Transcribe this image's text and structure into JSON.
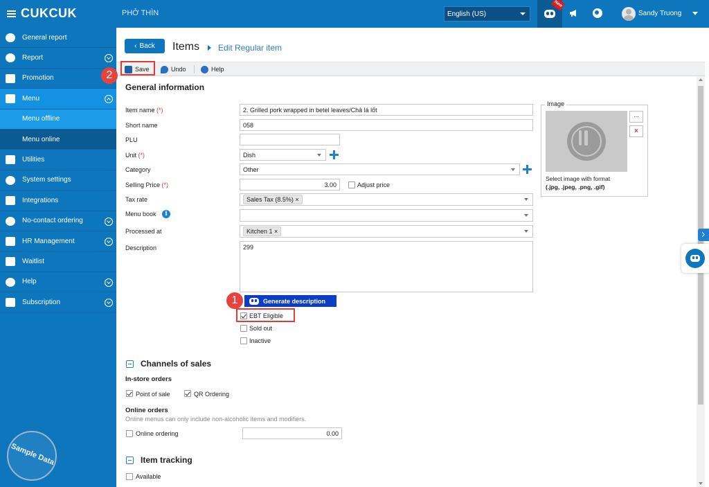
{
  "topbar": {
    "logo": "CUKCUK",
    "restaurant": "PHỞ THÌN",
    "language": "English (US)",
    "new_badge": "New",
    "user_name": "Sandy Truong"
  },
  "sidebar": {
    "items": [
      {
        "label": "General report"
      },
      {
        "label": "Report"
      },
      {
        "label": "Promotion"
      },
      {
        "label": "Menu"
      },
      {
        "label": "Menu offline"
      },
      {
        "label": "Menu online"
      },
      {
        "label": "Utilities"
      },
      {
        "label": "System settings"
      },
      {
        "label": "Integrations"
      },
      {
        "label": "No-contact ordering"
      },
      {
        "label": "HR Management"
      },
      {
        "label": "Waitlist"
      },
      {
        "label": "Help"
      },
      {
        "label": "Subscription"
      }
    ],
    "badge": "Sample Data"
  },
  "header": {
    "back_label": "Back",
    "title": "Items",
    "subtitle": "Edit Regular item"
  },
  "toolbar": {
    "save_label": "Save",
    "undo_label": "Undo",
    "help_label": "Help"
  },
  "markers": {
    "one": "1",
    "two": "2"
  },
  "general": {
    "title": "General information",
    "required_mark": "(*)",
    "item_name_label": "Item name",
    "item_name_value": "2. Grilled pork wrapped in betel leaves/Chả lá lốt",
    "short_name_label": "Short name",
    "short_name_value": "058",
    "plu_label": "PLU",
    "plu_value": "",
    "unit_label": "Unit",
    "unit_value": "Dish",
    "category_label": "Category",
    "category_value": "Other",
    "selling_price_label": "Selling Price",
    "selling_price_value": "3.00",
    "adjust_price_label": "Adjust price",
    "tax_rate_label": "Tax rate",
    "tax_rate_tag": "Sales Tax (8.5%)",
    "menu_book_label": "Menu book",
    "processed_at_label": "Processed at",
    "processed_at_tag": "Kitchen 1",
    "description_label": "Description",
    "description_value": "299",
    "generate_label": "Generate description",
    "ebt_label": "EBT Eligible",
    "sold_out_label": "Sold out",
    "inactive_label": "Inactive",
    "tag_remove": "×"
  },
  "image": {
    "legend": "Image",
    "browse_label": "...",
    "delete_label": "×",
    "hint_line1": "Select image with format",
    "hint_line2": "(.jpg, .jpeg, .png, .gif)"
  },
  "channels": {
    "title": "Channels of sales",
    "instore_title": "In-store orders",
    "point_of_sale_label": "Point of sale",
    "qr_label": "QR Ordering",
    "online_title": "Online orders",
    "online_note": "Online menus can only include non-alcoholic items and modifiers.",
    "online_ordering_label": "Online ordering",
    "online_price": "0.00"
  },
  "tracking": {
    "title": "Item tracking",
    "available_label": "Available"
  },
  "colors": {
    "brand": "#0e76bc",
    "highlight": "#e53935",
    "generate_button": "#0c3dc6"
  }
}
